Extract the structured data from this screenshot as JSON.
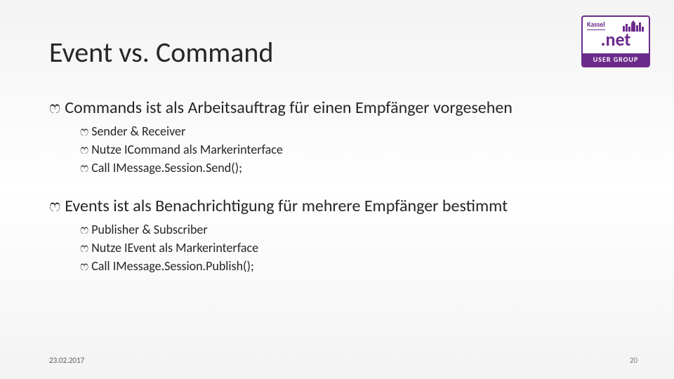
{
  "title": "Event vs. Command",
  "bullet_glyph": "ෆ",
  "sections": [
    {
      "heading": "Commands ist als Arbeitsauftrag für einen Empfänger vorgesehen",
      "items": [
        "Sender & Receiver",
        "Nutze ICommand als Markerinterface",
        "Call IMessage.Session.Send();"
      ]
    },
    {
      "heading": "Events ist als Benachrichtigung für mehrere Empfänger bestimmt",
      "items": [
        "Publisher & Subscriber",
        "Nutze IEvent als Markerinterface",
        "Call IMessage.Session.Publish();"
      ]
    }
  ],
  "footer": {
    "date": "23.02.2017",
    "page": "20"
  },
  "logo": {
    "city": "Kassel",
    "brand": ".net",
    "sub": "USER GROUP"
  }
}
